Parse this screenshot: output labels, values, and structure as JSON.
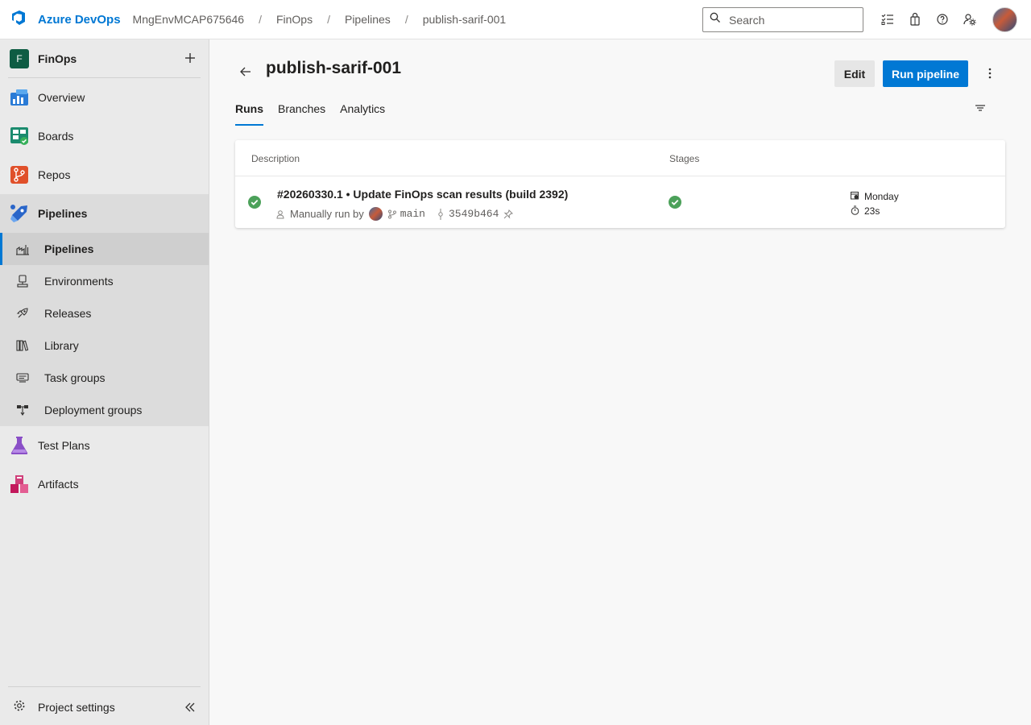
{
  "header": {
    "brand": "Azure DevOps",
    "breadcrumbs": [
      "MngEnvMCAP675646",
      "FinOps",
      "Pipelines",
      "publish-sarif-001"
    ],
    "breadcrumb_separator": "/",
    "search_placeholder": "Search"
  },
  "sidebar": {
    "project": {
      "badge": "F",
      "name": "FinOps"
    },
    "items": [
      {
        "label": "Overview"
      },
      {
        "label": "Boards"
      },
      {
        "label": "Repos"
      },
      {
        "label": "Pipelines"
      },
      {
        "label": "Test Plans"
      },
      {
        "label": "Artifacts"
      }
    ],
    "pipelines_sub": [
      {
        "label": "Pipelines"
      },
      {
        "label": "Environments"
      },
      {
        "label": "Releases"
      },
      {
        "label": "Library"
      },
      {
        "label": "Task groups"
      },
      {
        "label": "Deployment groups"
      }
    ],
    "settings_label": "Project settings"
  },
  "main": {
    "title": "publish-sarif-001",
    "edit_label": "Edit",
    "run_label": "Run pipeline",
    "tabs": [
      {
        "label": "Runs"
      },
      {
        "label": "Branches"
      },
      {
        "label": "Analytics"
      }
    ],
    "table": {
      "col_description": "Description",
      "col_stages": "Stages"
    },
    "run": {
      "title": "#20260330.1 • Update FinOps scan results (build 2392)",
      "trigger": "Manually run by",
      "branch": "main",
      "commit": "3549b464",
      "when": "Monday",
      "duration": "23s"
    }
  },
  "colors": {
    "accent": "#0078d4",
    "success": "#4ca15a",
    "project_badge": "#0e5c43"
  }
}
